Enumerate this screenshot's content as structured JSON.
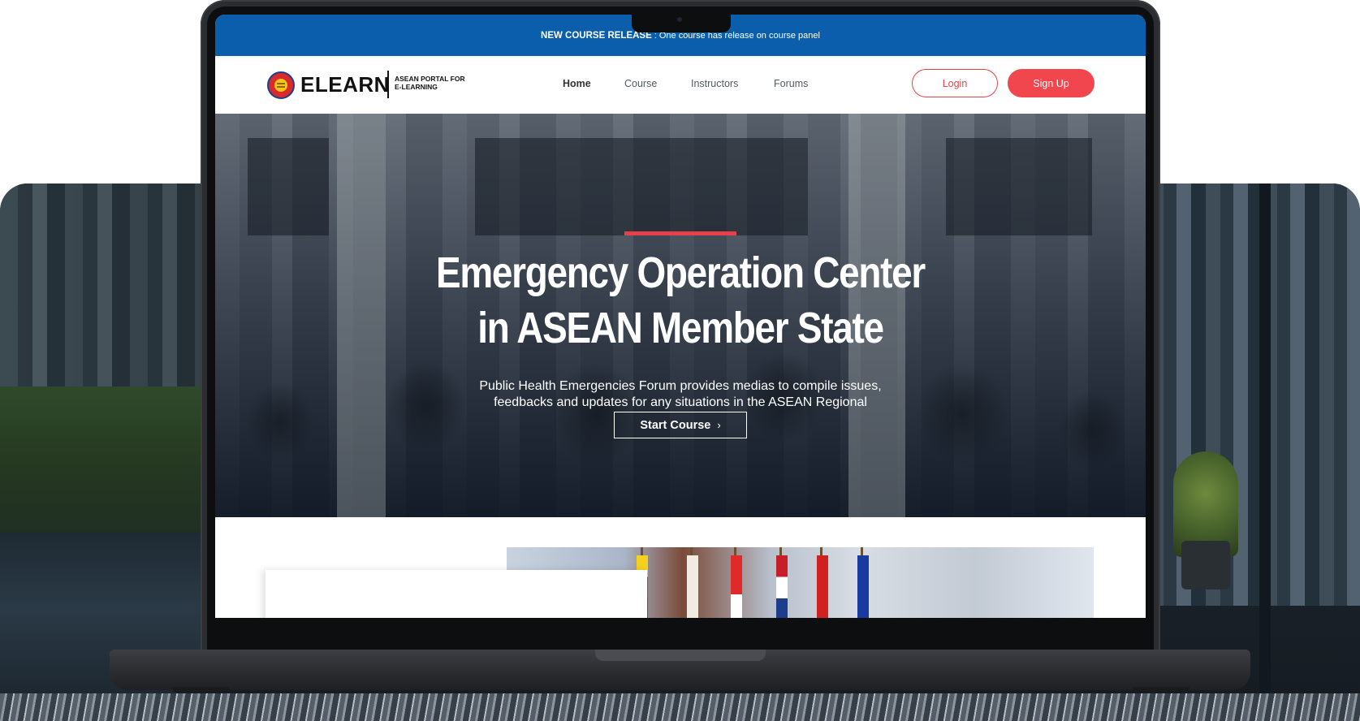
{
  "announcement": {
    "label": "NEW COURSE RELEASE",
    "separator": ":",
    "message": "One course has release on course panel"
  },
  "brand": {
    "name": "ELEARN",
    "tagline_line1": "ASEAN PORTAL FOR",
    "tagline_line2": "E-LEARNING"
  },
  "nav": {
    "items": [
      {
        "label": "Home",
        "active": true
      },
      {
        "label": "Course",
        "active": false
      },
      {
        "label": "Instructors",
        "active": false
      },
      {
        "label": "Forums",
        "active": false
      }
    ]
  },
  "auth": {
    "login_label": "Login",
    "signup_label": "Sign Up"
  },
  "hero": {
    "title_line1": "Emergency Operation Center",
    "title_line2": "in ASEAN Member State",
    "subtitle_line1": "Public Health Emergencies Forum provides medias to compile issues,",
    "subtitle_line2": "feedbacks and updates for any situations in the ASEAN Regional",
    "cta_label": "Start Course",
    "cta_icon": "chevron-right-icon"
  },
  "colors": {
    "announcement_bg": "#0a5eab",
    "accent_red": "#f1464d",
    "hero_accent": "#e8404a"
  }
}
